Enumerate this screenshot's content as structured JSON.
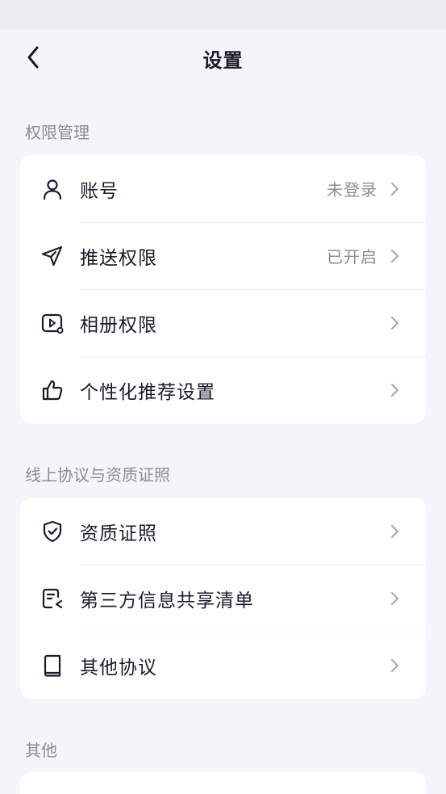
{
  "header": {
    "title": "设置"
  },
  "sections": [
    {
      "title": "权限管理",
      "items": [
        {
          "label": "账号",
          "value": "未登录",
          "icon": "user-icon"
        },
        {
          "label": "推送权限",
          "value": "已开启",
          "icon": "send-icon"
        },
        {
          "label": "相册权限",
          "value": "",
          "icon": "album-icon"
        },
        {
          "label": "个性化推荐设置",
          "value": "",
          "icon": "thumbs-up-icon"
        }
      ]
    },
    {
      "title": "线上协议与资质证照",
      "items": [
        {
          "label": "资质证照",
          "icon": "shield-check-icon"
        },
        {
          "label": "第三方信息共享清单",
          "icon": "share-list-icon"
        },
        {
          "label": "其他协议",
          "icon": "book-icon"
        }
      ]
    },
    {
      "title": "其他",
      "items": []
    }
  ]
}
